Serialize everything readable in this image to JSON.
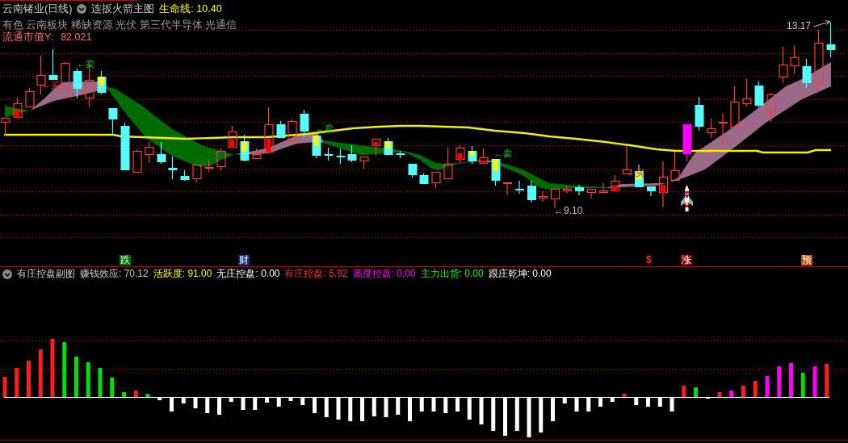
{
  "main_chart": {
    "stock": "云南锗业(日线)",
    "indicator": "连扳火箭主图",
    "life_line": {
      "label": "生命线:",
      "value": "10.40"
    },
    "sectors": "有色 云南板块 稀缺资源 光伏 第三代半导体 光通信",
    "market_cap": {
      "label": "流通市值Y:",
      "value": "82.021"
    },
    "high_label": "13.17",
    "low_label": "←9.10",
    "signals": [
      {
        "kind": "buy",
        "label": "←买"
      },
      {
        "kind": "sell",
        "label": "←卖"
      },
      {
        "kind": "sell",
        "label": "←卖"
      },
      {
        "kind": "sell",
        "label": "←卖"
      },
      {
        "kind": "buy",
        "label": "←买"
      }
    ],
    "event_tags": [
      {
        "kind": "fall",
        "label": "跌"
      },
      {
        "kind": "wealth",
        "label": "财"
      },
      {
        "kind": "money",
        "label": "$"
      },
      {
        "kind": "rise",
        "label": "涨"
      },
      {
        "kind": "forecast",
        "label": "预"
      }
    ]
  },
  "sub_chart": {
    "title": "有庄控盘副图",
    "indicators": [
      {
        "label": "赚钱效应:",
        "value": "70.12",
        "color": "#c8c8c8"
      },
      {
        "label": "活跃度:",
        "value": "91.00",
        "color": "#ffff00"
      },
      {
        "label": "无庄控盘:",
        "value": "0.00",
        "color": "#ffffff"
      },
      {
        "label": "有庄控盘:",
        "value": "5.92",
        "color": "#ff3232"
      },
      {
        "label": "高度控盘:",
        "value": "0.00",
        "color": "#ff00ff"
      },
      {
        "label": "主力出货:",
        "value": "0.00",
        "color": "#00ff00"
      },
      {
        "label": "跟庄乾坤:",
        "value": "0.00",
        "color": "#ffffff"
      }
    ]
  }
}
